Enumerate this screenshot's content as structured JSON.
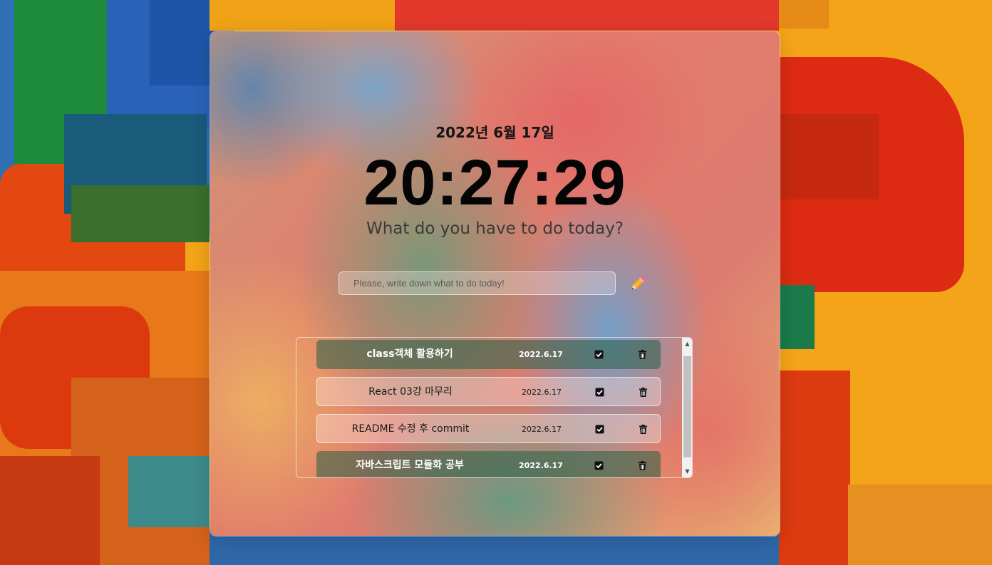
{
  "header": {
    "date": "2022년 6월 17일",
    "clock": "20:27:29",
    "question": "What do you have to do today?"
  },
  "input": {
    "placeholder": "Please, write down what to do today!",
    "value": ""
  },
  "icons": {
    "add": "pencil-icon",
    "complete": "check-square-icon",
    "delete": "trash-icon",
    "scroll_up": "arrow-up-icon",
    "scroll_down": "arrow-down-icon"
  },
  "scroll": {
    "up": "▲",
    "down": "▼"
  },
  "todos": [
    {
      "title": "class객체 활용하기",
      "date": "2022.6.17",
      "done": true
    },
    {
      "title": "React 03강 마무리",
      "date": "2022.6.17",
      "done": false
    },
    {
      "title": "README 수정 후 commit",
      "date": "2022.6.17",
      "done": false
    },
    {
      "title": "자바스크립트 모듈화 공부",
      "date": "2022.6.17",
      "done": true
    }
  ],
  "colors": {
    "done_item": "#285f46",
    "background": "#f2a317"
  }
}
